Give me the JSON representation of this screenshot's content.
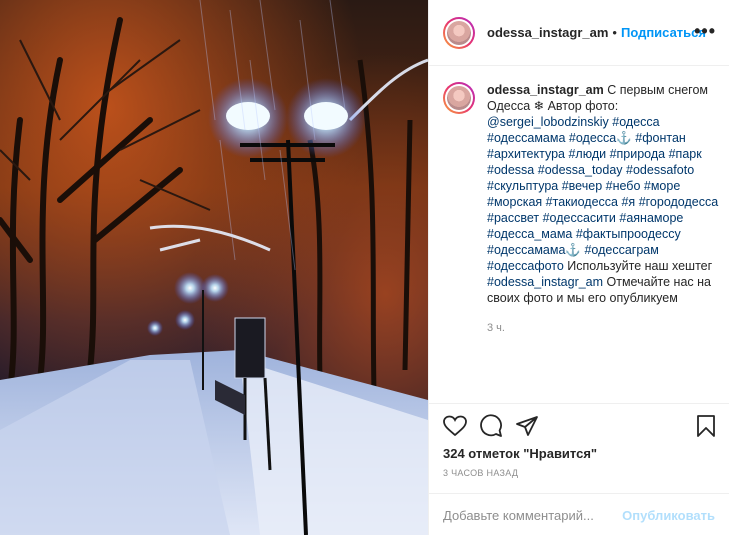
{
  "post": {
    "username": "odessa_instagr_am",
    "dot": "•",
    "follow_label": "Подписаться",
    "more_label": "•••"
  },
  "caption": {
    "username": "odessa_instagr_am",
    "text_parts": [
      {
        "t": " С первым снегом Одесса ❄",
        "tag": false
      },
      {
        "t": " Автор фото: ",
        "tag": false
      },
      {
        "t": "@sergei_lobodzinskiy",
        "tag": true
      },
      {
        "t": " ",
        "tag": false
      },
      {
        "t": "#одесса",
        "tag": true
      },
      {
        "t": " ",
        "tag": false
      },
      {
        "t": "#одессамама",
        "tag": true
      },
      {
        "t": " ",
        "tag": false
      },
      {
        "t": "#одесса⚓",
        "tag": true
      },
      {
        "t": " ",
        "tag": false
      },
      {
        "t": "#фонтан",
        "tag": true
      },
      {
        "t": " ",
        "tag": false
      },
      {
        "t": "#архитектура",
        "tag": true
      },
      {
        "t": " ",
        "tag": false
      },
      {
        "t": "#люди",
        "tag": true
      },
      {
        "t": " ",
        "tag": false
      },
      {
        "t": "#природа",
        "tag": true
      },
      {
        "t": " ",
        "tag": false
      },
      {
        "t": "#парк",
        "tag": true
      },
      {
        "t": " ",
        "tag": false
      },
      {
        "t": "#odessa",
        "tag": true
      },
      {
        "t": " ",
        "tag": false
      },
      {
        "t": "#odessa_today",
        "tag": true
      },
      {
        "t": " ",
        "tag": false
      },
      {
        "t": "#odessafoto",
        "tag": true
      },
      {
        "t": " ",
        "tag": false
      },
      {
        "t": "#скульптура",
        "tag": true
      },
      {
        "t": " ",
        "tag": false
      },
      {
        "t": "#вечер",
        "tag": true
      },
      {
        "t": " ",
        "tag": false
      },
      {
        "t": "#небо",
        "tag": true
      },
      {
        "t": " ",
        "tag": false
      },
      {
        "t": "#море",
        "tag": true
      },
      {
        "t": " ",
        "tag": false
      },
      {
        "t": "#морская",
        "tag": true
      },
      {
        "t": " ",
        "tag": false
      },
      {
        "t": "#такиодесса",
        "tag": true
      },
      {
        "t": " ",
        "tag": false
      },
      {
        "t": "#я",
        "tag": true
      },
      {
        "t": " ",
        "tag": false
      },
      {
        "t": "#горододесса",
        "tag": true
      },
      {
        "t": " ",
        "tag": false
      },
      {
        "t": "#рассвет",
        "tag": true
      },
      {
        "t": " ",
        "tag": false
      },
      {
        "t": "#одессасити",
        "tag": true
      },
      {
        "t": " ",
        "tag": false
      },
      {
        "t": "#аянаморе",
        "tag": true
      },
      {
        "t": " ",
        "tag": false
      },
      {
        "t": "#одесса_мама",
        "tag": true
      },
      {
        "t": " ",
        "tag": false
      },
      {
        "t": "#фактыпроодессу",
        "tag": true
      },
      {
        "t": " ",
        "tag": false
      },
      {
        "t": "#одессамама⚓",
        "tag": true
      },
      {
        "t": " ",
        "tag": false
      },
      {
        "t": "#одессаграм",
        "tag": true
      },
      {
        "t": " ",
        "tag": false
      },
      {
        "t": "#одессафото",
        "tag": true
      },
      {
        "t": " Используйте наш хештег ",
        "tag": false
      },
      {
        "t": "#odessa_instagr_am",
        "tag": true
      },
      {
        "t": " Отмечайте нас на своих фото и мы его опубликуем",
        "tag": false
      }
    ],
    "time": "3 ч."
  },
  "actions": {
    "like_icon": "heart-icon",
    "comment_icon": "comment-icon",
    "share_icon": "send-icon",
    "save_icon": "bookmark-icon"
  },
  "likes_text": "324 отметок \"Нравится\"",
  "time_ago": "3 ЧАСОВ НАЗАД",
  "comment_input": {
    "placeholder": "Добавьте комментарий...",
    "publish_label": "Опубликовать"
  },
  "colors": {
    "link": "#00376b",
    "follow": "#0095f6",
    "publish_disabled": "#b2dffc"
  }
}
